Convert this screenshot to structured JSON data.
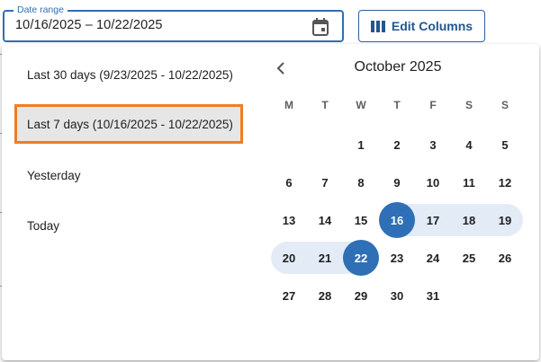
{
  "date_field": {
    "label": "Date range",
    "value": "10/16/2025 – 10/22/2025"
  },
  "edit_columns": {
    "label": "Edit Columns"
  },
  "presets": [
    {
      "label": "Last 30 days (9/23/2025 - 10/22/2025)",
      "selected": false
    },
    {
      "label": "Last 7 days (10/16/2025 - 10/22/2025)",
      "selected": true
    },
    {
      "label": "Yesterday",
      "selected": false
    },
    {
      "label": "Today",
      "selected": false
    }
  ],
  "calendar": {
    "month_title": "October 2025",
    "weekdays": [
      "M",
      "T",
      "W",
      "T",
      "F",
      "S",
      "S"
    ],
    "weeks": [
      [
        "",
        "",
        "1",
        "2",
        "3",
        "4",
        "5"
      ],
      [
        "6",
        "7",
        "8",
        "9",
        "10",
        "11",
        "12"
      ],
      [
        "13",
        "14",
        "15",
        "16",
        "17",
        "18",
        "19"
      ],
      [
        "20",
        "21",
        "22",
        "23",
        "24",
        "25",
        "26"
      ],
      [
        "27",
        "28",
        "29",
        "30",
        "31",
        "",
        ""
      ]
    ],
    "range_start": "16",
    "range_end": "22"
  },
  "colors": {
    "accent": "#2f6fb5",
    "range_fill": "#e3ecf6",
    "highlight_outline": "#ef7d22"
  }
}
